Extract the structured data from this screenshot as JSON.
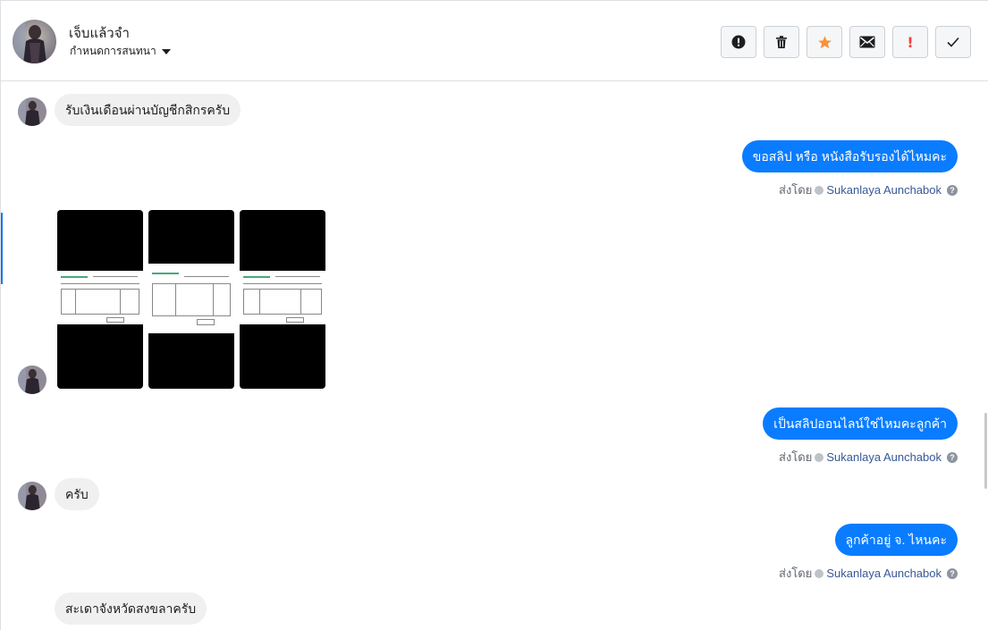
{
  "header": {
    "contact_name": "เจ็บแล้วจำ",
    "assign_label": "กำหนดการสนทนา",
    "toolbar": [
      {
        "name": "spam-button",
        "icon": "alert-circle-icon"
      },
      {
        "name": "delete-button",
        "icon": "trash-icon"
      },
      {
        "name": "star-button",
        "icon": "star-icon",
        "color": "#f7923b"
      },
      {
        "name": "mark-unread-button",
        "icon": "envelope-icon"
      },
      {
        "name": "follow-up-button",
        "icon": "exclamation-icon",
        "text": "!",
        "color": "#fa3e3e"
      },
      {
        "name": "mark-done-button",
        "icon": "checkmark-icon"
      }
    ]
  },
  "messages": {
    "m1": "รับเงินเดือนผ่านบัญชีกสิกรครับ",
    "m2": "ขอสลิป หรือ หนังสือรับรองได้ไหมคะ",
    "m4": "เป็นสลิปออนไลน์ใช่ไหมคะลูกค้า",
    "m5": "ครับ",
    "m6": "ลูกค้าอยู่ จ. ไหนคะ",
    "m7": "สะเดาจังหวัดสงขลาครับ"
  },
  "sent_by": {
    "label": "ส่งโดย",
    "agent": "Sukanlaya Aunchabok"
  },
  "colors": {
    "outgoing_bubble": "#0a7cff",
    "incoming_bubble": "#f0f0f0"
  }
}
